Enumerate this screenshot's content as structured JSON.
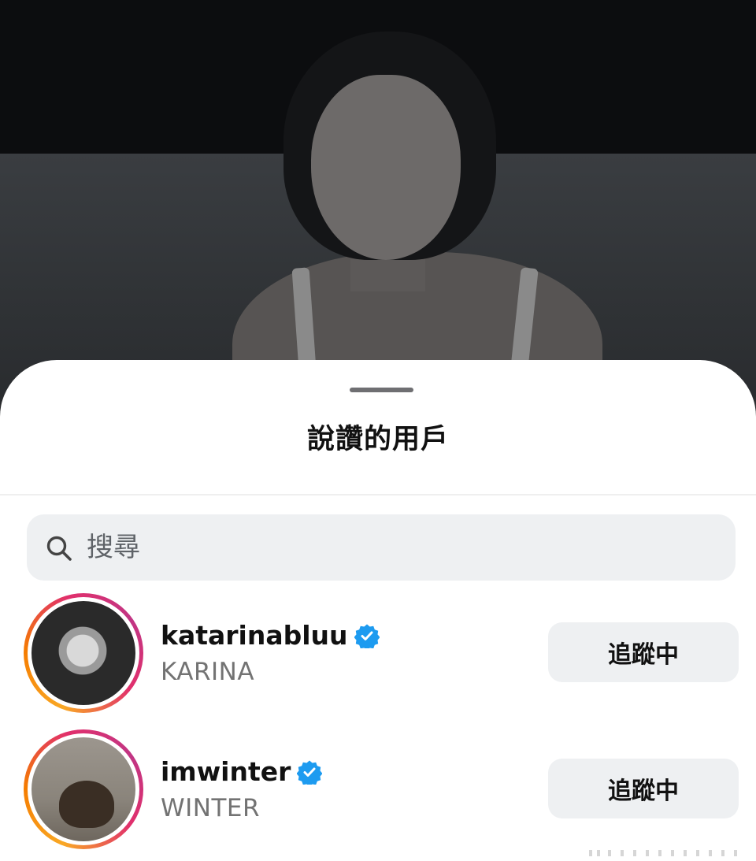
{
  "sheet": {
    "title": "說讚的用戶"
  },
  "search": {
    "placeholder": "搜尋"
  },
  "users": [
    {
      "username": "katarinabluu",
      "display_name": "KARINA",
      "verified": true,
      "follow_label": "追蹤中"
    },
    {
      "username": "imwinter",
      "display_name": "WINTER",
      "verified": true,
      "follow_label": "追蹤中"
    }
  ],
  "colors": {
    "verified_badge": "#1d9bf0",
    "button_bg": "#eef0f2",
    "secondary_text": "#737373"
  }
}
